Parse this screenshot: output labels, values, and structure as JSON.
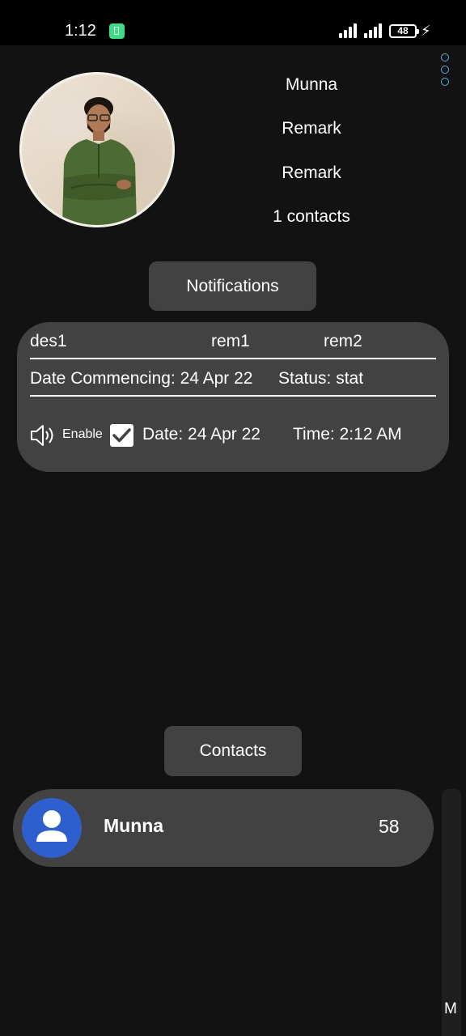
{
  "status_bar": {
    "time": "1:12",
    "battery_level": "48",
    "icons": [
      "battery-saver-icon",
      "signal-icon",
      "signal-icon",
      "battery-icon",
      "charging-icon"
    ]
  },
  "profile": {
    "name": "Munna",
    "remark_1": "Remark",
    "remark_2": "Remark",
    "contacts_count": "1 contacts"
  },
  "notifications_button": "Notifications",
  "notification": {
    "description": "des1",
    "rem1": "rem1",
    "rem2": "rem2",
    "date_commencing": "Date Commencing: 24 Apr 22",
    "status": "Status: stat",
    "sound_label": "Enable",
    "checked": true,
    "date": "Date: 24 Apr 22",
    "time": "Time: 2:12 AM"
  },
  "contacts_button": "Contacts",
  "contacts": [
    {
      "name": "Munna",
      "count": "58"
    }
  ],
  "index_letter": "M",
  "colors": {
    "background": "#121212",
    "card": "#424242",
    "accent": "#5aaee0",
    "avatar_blue": "#2f5fcf"
  }
}
